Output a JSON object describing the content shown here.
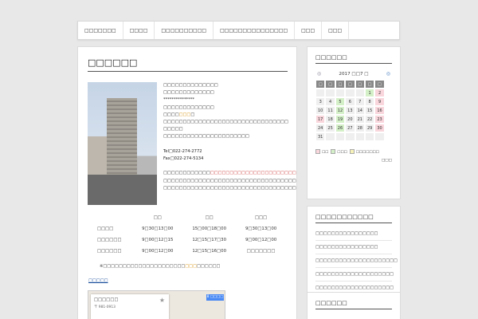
{
  "nav": [
    "□□□□□□□",
    "□□□□",
    "□□□□□□□□□□",
    "□□□□□□□□□□□□□□□",
    "□□□",
    "□□□"
  ],
  "main": {
    "title": "□□□□□□",
    "info_lines": [
      "□□□□□□□□□□□□□□",
      "□□□□□□□□□□□□□",
      "***************",
      "□□□□□□□□□□□□□"
    ],
    "info_line5_pre": "□□□□",
    "info_line5_hl": "□□□",
    "info_line5_post": "□",
    "info_lines_b": [
      "□□□□□□□□□□□□□□□□□□□□□□□□□□□□□□□□",
      "□□□□□",
      "□□□□□□□□□□□□□□□□□□□□□□"
    ],
    "tel": "Tel□022-274-2772",
    "fax": "Fax□022-274-5134",
    "desc_pre": "□□□□□□□□□□□□",
    "desc_hl": "□□□□□□□□□□□□□□□□□□□□□□□",
    "desc_post": "□□□□□□□□",
    "desc_lines": [
      "□□□□□□□□□□□□□□□□□□□□□□□□□□□□□□□□□□□□□□□□",
      "□□□□□□□□□□□□□□□□□□□□□□□□□□□□□□□□□□□□"
    ],
    "hours_header": [
      "",
      "□□",
      "□□",
      "□□□"
    ],
    "hours_rows": [
      [
        "□□□□",
        "9□30□13□00",
        "15□00□18□00",
        "9□30□13□00"
      ],
      [
        "□□□□□□",
        "9□00□12□15",
        "12□15□17□30",
        "9□00□12□00"
      ],
      [
        "□□□□□□",
        "9□00□12□00",
        "12□15□16□00",
        "□□□□□□□"
      ]
    ],
    "note_pre": "※□□□□□□□□□□□□□□□□□□□□□",
    "note_hl": "□□□",
    "note_post": "□□□□□□",
    "map_link": "□□□□□",
    "map_card_title": "□□□□□□",
    "map_card_addr": "〒 981-0913",
    "map_btn": "8 □□□□"
  },
  "calendar": {
    "widget_title": "□□□□□□",
    "month_label": "2017 □□7 □",
    "dow": [
      "□",
      "□",
      "□",
      "□",
      "□",
      "□",
      "□"
    ],
    "weeks": [
      [
        "",
        "",
        "",
        "",
        "",
        "1",
        "2"
      ],
      [
        "3",
        "4",
        "5",
        "6",
        "7",
        "8",
        "9"
      ],
      [
        "10",
        "11",
        "12",
        "13",
        "14",
        "15",
        "16"
      ],
      [
        "17",
        "18",
        "19",
        "20",
        "21",
        "22",
        "23"
      ],
      [
        "24",
        "25",
        "26",
        "27",
        "28",
        "29",
        "30"
      ],
      [
        "31",
        "",
        "",
        "",
        "",
        "",
        ""
      ]
    ],
    "green_days": [
      "1",
      "5",
      "12",
      "19",
      "26"
    ],
    "pink_days": [
      "2",
      "9",
      "16",
      "17",
      "23",
      "30"
    ],
    "legend": [
      "□□",
      "□□□",
      "□□□□□□□"
    ],
    "legend_colors": [
      "#f8d6dc",
      "#d4f0c8",
      "#f7f2b8"
    ],
    "more": "□□□"
  },
  "news": {
    "widget_title": "□□□□□□□□□□□",
    "items": [
      "□□□□□□□□□□□□□□□□",
      "□□□□□□□□□□□□□□□□",
      "□□□□□□□□□□□□□□□□□□□□□",
      "□□□□□□□□□□□□□□□□□□□□",
      "□□□□□□□□□□□□□□□□□□□□"
    ]
  },
  "widget3": {
    "widget_title": "□□□□□□"
  }
}
